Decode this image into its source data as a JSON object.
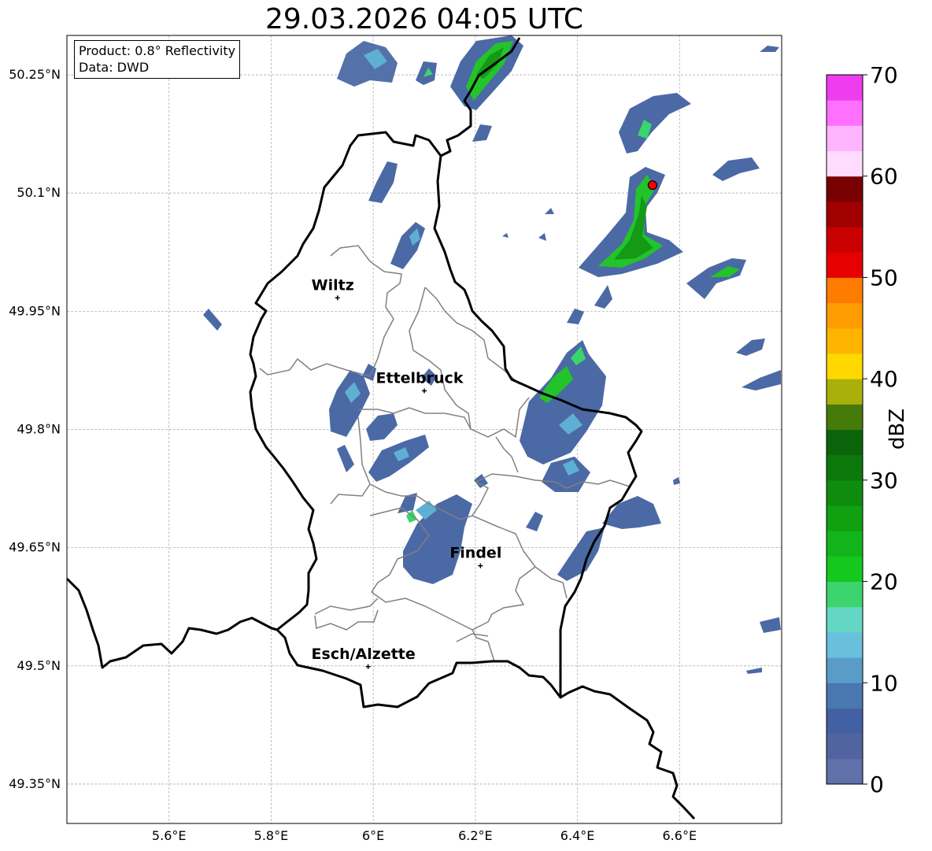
{
  "title": "29.03.2026 04:05 UTC",
  "info": {
    "product_line": "Product: 0.8° Reflectivity",
    "data_line": "Data: DWD"
  },
  "map": {
    "lon_range": [
      5.4,
      6.8
    ],
    "lat_range": [
      49.3,
      50.3
    ],
    "lat_ticks": [
      {
        "value": 50.25,
        "label": "50.25°N"
      },
      {
        "value": 50.1,
        "label": "50.1°N"
      },
      {
        "value": 49.95,
        "label": "49.95°N"
      },
      {
        "value": 49.8,
        "label": "49.8°N"
      },
      {
        "value": 49.65,
        "label": "49.65°N"
      },
      {
        "value": 49.5,
        "label": "49.5°N"
      },
      {
        "value": 49.35,
        "label": "49.35°N"
      }
    ],
    "lon_ticks": [
      {
        "value": 5.6,
        "label": "5.6°E"
      },
      {
        "value": 5.8,
        "label": "5.8°E"
      },
      {
        "value": 6.0,
        "label": "6°E"
      },
      {
        "value": 6.2,
        "label": "6.2°E"
      },
      {
        "value": 6.4,
        "label": "6.4°E"
      },
      {
        "value": 6.6,
        "label": "6.6°E"
      }
    ],
    "cities": [
      {
        "name": "Wiltz",
        "lon": 5.93,
        "lat": 49.967
      },
      {
        "name": "Ettelbruck",
        "lon": 6.1,
        "lat": 49.849
      },
      {
        "name": "Findel",
        "lon": 6.21,
        "lat": 49.627
      },
      {
        "name": "Esch/Alzette",
        "lon": 5.99,
        "lat": 49.499
      }
    ],
    "radar_site": {
      "lon": 6.547,
      "lat": 50.11,
      "color": "#ff0000"
    }
  },
  "colorbar": {
    "label": "dBZ",
    "ticks": [
      {
        "value": 0,
        "label": "0"
      },
      {
        "value": 10,
        "label": "10"
      },
      {
        "value": 20,
        "label": "20"
      },
      {
        "value": 30,
        "label": "30"
      },
      {
        "value": 40,
        "label": "40"
      },
      {
        "value": 50,
        "label": "50"
      },
      {
        "value": 60,
        "label": "60"
      },
      {
        "value": 70,
        "label": "70"
      }
    ],
    "colors": [
      "#6070a8",
      "#5264a0",
      "#4460a4",
      "#4a78b0",
      "#5a9cc8",
      "#68c0dc",
      "#64d6c4",
      "#3cd46c",
      "#14c81e",
      "#12b41c",
      "#10a010",
      "#0e8c0e",
      "#0c780c",
      "#0a640a",
      "#467a0a",
      "#aab00a",
      "#ffd800",
      "#ffb400",
      "#ff9c00",
      "#ff7c00",
      "#e60000",
      "#c80000",
      "#a00000",
      "#780000",
      "#ffdcff",
      "#ffb4ff",
      "#ff70ff",
      "#ee3cee"
    ]
  },
  "echo_colors": {
    "low": "#4b69a5",
    "mid": "#5eb0d2",
    "teal": "#62d2c2",
    "green": "#22c42a",
    "dark_green": "#149a16"
  }
}
